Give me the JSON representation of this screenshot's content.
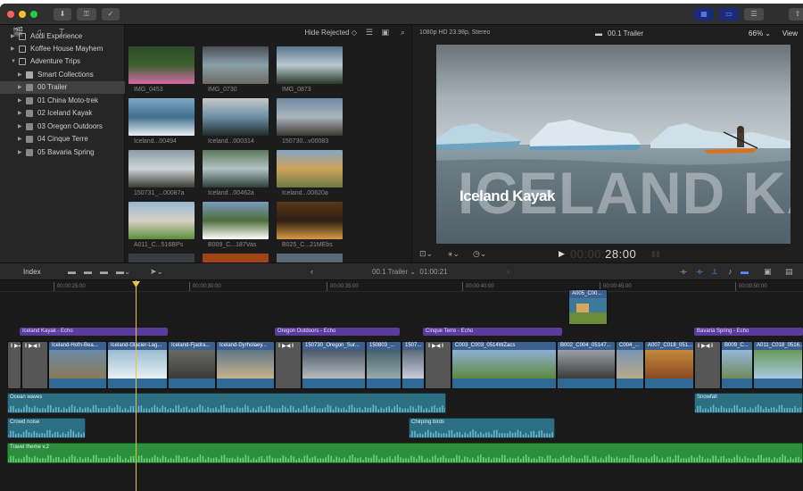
{
  "colors": {
    "accent": "#e8c44a",
    "selection": "#404040",
    "connected_title": "#5a3c9c",
    "video_clip": "#3b5f8e",
    "audio_clip": "#2c6e82",
    "music_clip": "#2c8f3c"
  },
  "titlebar": {
    "import_icon": "download-icon",
    "keyword_icon": "key-icon",
    "check_icon": "checkmark-icon"
  },
  "library": {
    "items": [
      {
        "label": "Audi Experience",
        "icon": "library-icon"
      },
      {
        "label": "Koffee House Mayhem",
        "icon": "library-icon"
      },
      {
        "label": "Adventure Trips",
        "icon": "library-icon"
      },
      {
        "label": "Smart Collections",
        "icon": "folder-icon"
      },
      {
        "label": "00 Trailer",
        "icon": "event-icon",
        "selected": true
      },
      {
        "label": "01 China Moto-trek",
        "icon": "event-icon"
      },
      {
        "label": "02 Iceland Kayak",
        "icon": "event-icon"
      },
      {
        "label": "03 Oregon Outdoors",
        "icon": "event-icon"
      },
      {
        "label": "04 Cinque Terre",
        "icon": "event-icon"
      },
      {
        "label": "05 Bavaria Spring",
        "icon": "event-icon"
      }
    ]
  },
  "browser": {
    "filter_label": "Hide Rejected ◇",
    "clips": [
      {
        "name": "IMG_0453"
      },
      {
        "name": "IMG_0730"
      },
      {
        "name": "IMG_0873"
      },
      {
        "name": "Iceland...00494"
      },
      {
        "name": "Iceland...000314"
      },
      {
        "name": "150730...v00083"
      },
      {
        "name": "150731_...00087a"
      },
      {
        "name": "Iceland...00462a"
      },
      {
        "name": "Iceland...00620a"
      },
      {
        "name": "A011_C...516BPs"
      },
      {
        "name": "B009_C...187Vas"
      },
      {
        "name": "B025_C...21MEbs"
      }
    ]
  },
  "viewer": {
    "format": "1080p HD 23.98p, Stereo",
    "project": "00.1 Trailer",
    "zoom": "66%",
    "view_label": "View",
    "title_small": "Iceland Kayak",
    "title_big": "ICELAND KAYAK",
    "timecode_dim": "00:00:",
    "timecode_bright": "28:00"
  },
  "timeline_bar": {
    "index_label": "Index",
    "project": "00.1 Trailer ⌄",
    "duration": "01:00:21"
  },
  "timeline": {
    "ruler": [
      "00:00:25:00",
      "00:00:30:00",
      "00:00:35:00",
      "00:00:40:00",
      "00:00:45:00",
      "00:00:50:00"
    ],
    "connected_titles": [
      "Iceland Kayak - Echo",
      "Oregon Outdoors - Echo",
      "Cinque Terre - Echo",
      "Bavaria Spring - Echo"
    ],
    "connected_clip": "A005_C00...",
    "storyline": [
      "Iceland-Hofn-Bea...",
      "Iceland-Glacier-Lag...",
      "Iceland-Fjadra...",
      "Iceland-Dyrholaey...",
      "150730_Oregon_Sur...",
      "150803_...",
      "1507...",
      "C003_C003_0514WZacs",
      "B002_C004_05147...",
      "C004_...",
      "A007_C018_051...",
      "B009_C...",
      "A011_C018_0516..."
    ],
    "audio": [
      "Ocean waves",
      "Crowd noise",
      "Chirping birds",
      "Snowfall",
      "Travel theme v.2"
    ]
  }
}
